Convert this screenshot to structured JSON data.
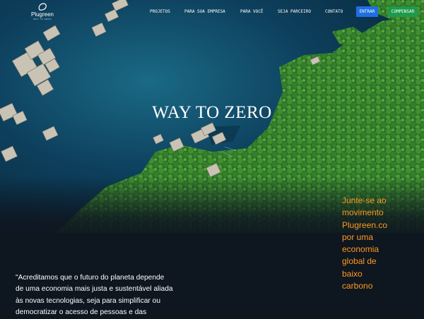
{
  "header": {
    "logo": {
      "name": "Plugreen",
      "tagline": "WAY TO ZERO"
    },
    "nav": [
      "PROJETOS",
      "PARA SUA EMPRESA",
      "PARA VOCÊ",
      "SEJA PARCEIRO",
      "CONTATO"
    ],
    "login_label": "ENTRAR",
    "offset_label": "COMPENSAR"
  },
  "hero": {
    "title": "WAY TO ZERO",
    "cta_lines": [
      "Junte-se ao",
      "movimento",
      "Plugreen.co",
      "por uma",
      "economia",
      "global de",
      "baixo",
      "carbono"
    ]
  },
  "quote_lines": [
    "\"Acreditamos que o futuro do planeta depende",
    "de uma economia mais justa e sustentável aliada",
    "às novas tecnologias, seja para simplificar ou",
    "democratizar o acesso de pessoas e das"
  ],
  "colors": {
    "background": "#0e1620",
    "accent_orange": "#ff9a1e",
    "login_blue": "#1e6fe0",
    "offset_green": "#1f9a4c",
    "water": "#0b3a55",
    "forest": "#2f7a2a"
  }
}
